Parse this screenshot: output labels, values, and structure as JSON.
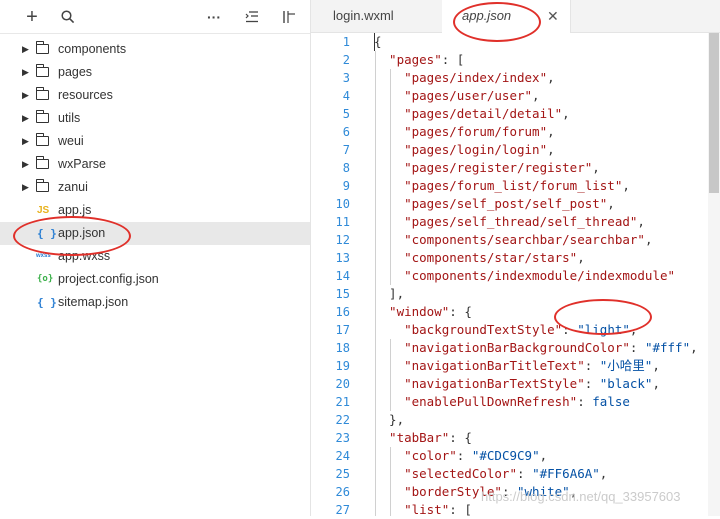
{
  "toolbar": {
    "icons": [
      "plus-icon",
      "search-icon",
      "more-icon",
      "collapse-icon",
      "split-icon"
    ],
    "plus_glyph": "+",
    "more_glyph": "···"
  },
  "files": [
    {
      "type": "folder",
      "label": "components"
    },
    {
      "type": "folder",
      "label": "pages"
    },
    {
      "type": "folder",
      "label": "resources"
    },
    {
      "type": "folder",
      "label": "utils"
    },
    {
      "type": "folder",
      "label": "weui"
    },
    {
      "type": "folder",
      "label": "wxParse"
    },
    {
      "type": "folder",
      "label": "zanui"
    },
    {
      "type": "js",
      "icon": "JS",
      "label": "app.js"
    },
    {
      "type": "json",
      "icon": "{ }",
      "label": "app.json",
      "selected": true
    },
    {
      "type": "wxss",
      "icon": "wxss",
      "label": "app.wxss"
    },
    {
      "type": "config",
      "icon": "{o}",
      "label": "project.config.json"
    },
    {
      "type": "json",
      "icon": "{ }",
      "label": "sitemap.json"
    }
  ],
  "tabs": [
    {
      "label": "login.wxml",
      "active": false
    },
    {
      "label": "app.json",
      "active": true,
      "close": "✕"
    }
  ],
  "code_lines": [
    {
      "n": 1,
      "segs": [
        {
          "t": "{",
          "c": "p"
        }
      ]
    },
    {
      "n": 2,
      "segs": [
        {
          "t": "  \"pages\"",
          "c": "k"
        },
        {
          "t": ": [",
          "c": "p"
        }
      ]
    },
    {
      "n": 3,
      "segs": [
        {
          "t": "    \"pages/index/index\"",
          "c": "s"
        },
        {
          "t": ",",
          "c": "p"
        }
      ]
    },
    {
      "n": 4,
      "segs": [
        {
          "t": "    \"pages/user/user\"",
          "c": "s"
        },
        {
          "t": ",",
          "c": "p"
        }
      ]
    },
    {
      "n": 5,
      "segs": [
        {
          "t": "    \"pages/detail/detail\"",
          "c": "s"
        },
        {
          "t": ",",
          "c": "p"
        }
      ]
    },
    {
      "n": 6,
      "segs": [
        {
          "t": "    \"pages/forum/forum\"",
          "c": "s"
        },
        {
          "t": ",",
          "c": "p"
        }
      ]
    },
    {
      "n": 7,
      "segs": [
        {
          "t": "    \"pages/login/login\"",
          "c": "s"
        },
        {
          "t": ",",
          "c": "p"
        }
      ]
    },
    {
      "n": 8,
      "segs": [
        {
          "t": "    \"pages/register/register\"",
          "c": "s"
        },
        {
          "t": ",",
          "c": "p"
        }
      ]
    },
    {
      "n": 9,
      "segs": [
        {
          "t": "    \"pages/forum_list/forum_list\"",
          "c": "s"
        },
        {
          "t": ",",
          "c": "p"
        }
      ]
    },
    {
      "n": 10,
      "segs": [
        {
          "t": "    \"pages/self_post/self_post\"",
          "c": "s"
        },
        {
          "t": ",",
          "c": "p"
        }
      ]
    },
    {
      "n": 11,
      "segs": [
        {
          "t": "    \"pages/self_thread/self_thread\"",
          "c": "s"
        },
        {
          "t": ",",
          "c": "p"
        }
      ]
    },
    {
      "n": 12,
      "segs": [
        {
          "t": "    \"components/searchbar/searchbar\"",
          "c": "s"
        },
        {
          "t": ",",
          "c": "p"
        }
      ]
    },
    {
      "n": 13,
      "segs": [
        {
          "t": "    \"components/star/stars\"",
          "c": "s"
        },
        {
          "t": ",",
          "c": "p"
        }
      ]
    },
    {
      "n": 14,
      "segs": [
        {
          "t": "    \"components/indexmodule/indexmodule\"",
          "c": "s"
        }
      ]
    },
    {
      "n": 15,
      "segs": [
        {
          "t": "  ],",
          "c": "p"
        }
      ]
    },
    {
      "n": 16,
      "segs": [
        {
          "t": "  \"window\"",
          "c": "k"
        },
        {
          "t": ": {",
          "c": "p"
        }
      ]
    },
    {
      "n": 17,
      "segs": [
        {
          "t": "    \"backgroundTextStyle\"",
          "c": "k"
        },
        {
          "t": ": ",
          "c": "p"
        },
        {
          "t": "\"light\"",
          "c": "b"
        },
        {
          "t": ",",
          "c": "p"
        }
      ]
    },
    {
      "n": 18,
      "segs": [
        {
          "t": "    \"navigationBarBackgroundColor\"",
          "c": "k"
        },
        {
          "t": ": ",
          "c": "p"
        },
        {
          "t": "\"#fff\"",
          "c": "b"
        },
        {
          "t": ",",
          "c": "p"
        }
      ]
    },
    {
      "n": 19,
      "segs": [
        {
          "t": "    \"navigationBarTitleText\"",
          "c": "k"
        },
        {
          "t": ": ",
          "c": "p"
        },
        {
          "t": "\"小哈里\"",
          "c": "b"
        },
        {
          "t": ",",
          "c": "p"
        }
      ]
    },
    {
      "n": 20,
      "segs": [
        {
          "t": "    \"navigationBarTextStyle\"",
          "c": "k"
        },
        {
          "t": ": ",
          "c": "p"
        },
        {
          "t": "\"black\"",
          "c": "b"
        },
        {
          "t": ",",
          "c": "p"
        }
      ]
    },
    {
      "n": 21,
      "segs": [
        {
          "t": "    \"enablePullDownRefresh\"",
          "c": "k"
        },
        {
          "t": ": ",
          "c": "p"
        },
        {
          "t": "false",
          "c": "b"
        }
      ]
    },
    {
      "n": 22,
      "segs": [
        {
          "t": "  },",
          "c": "p"
        }
      ]
    },
    {
      "n": 23,
      "segs": [
        {
          "t": "  \"tabBar\"",
          "c": "k"
        },
        {
          "t": ": {",
          "c": "p"
        }
      ]
    },
    {
      "n": 24,
      "segs": [
        {
          "t": "    \"color\"",
          "c": "k"
        },
        {
          "t": ": ",
          "c": "p"
        },
        {
          "t": "\"#CDC9C9\"",
          "c": "b"
        },
        {
          "t": ",",
          "c": "p"
        }
      ]
    },
    {
      "n": 25,
      "segs": [
        {
          "t": "    \"selectedColor\"",
          "c": "k"
        },
        {
          "t": ": ",
          "c": "p"
        },
        {
          "t": "\"#FF6A6A\"",
          "c": "b"
        },
        {
          "t": ",",
          "c": "p"
        }
      ]
    },
    {
      "n": 26,
      "segs": [
        {
          "t": "    \"borderStyle\"",
          "c": "k"
        },
        {
          "t": ": ",
          "c": "p"
        },
        {
          "t": "\"white\"",
          "c": "b"
        },
        {
          "t": ",",
          "c": "p"
        }
      ]
    },
    {
      "n": 27,
      "segs": [
        {
          "t": "    \"list\"",
          "c": "k"
        },
        {
          "t": ": [",
          "c": "p"
        }
      ]
    }
  ],
  "watermark": "https://blog.csdn.net/qq_33957603",
  "annotation_color": "#e0302a"
}
